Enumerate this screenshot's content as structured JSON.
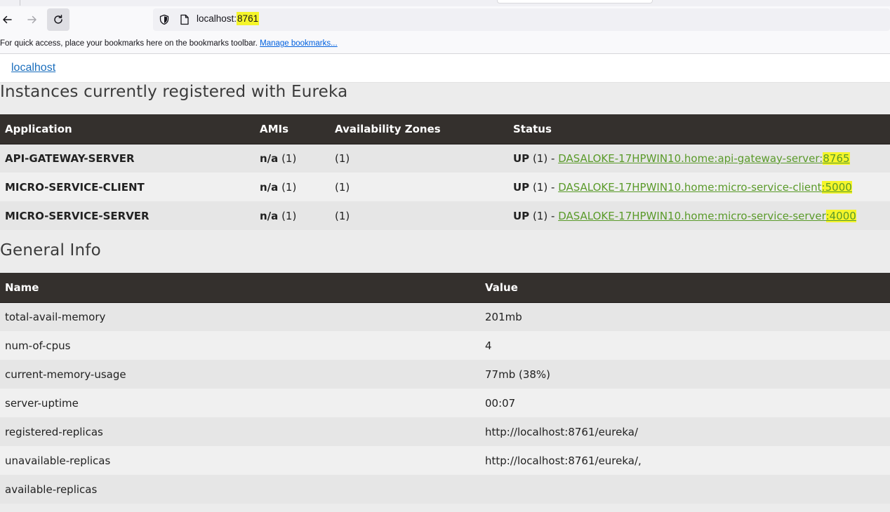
{
  "browser": {
    "url_host": "localhost:",
    "url_port": "8761",
    "bookmarks_message": "For quick access, place your bookmarks here on the bookmarks toolbar.",
    "manage_bookmarks": "Manage bookmarks..."
  },
  "header": {
    "brand": "localhost"
  },
  "instances": {
    "title": "Instances currently registered with Eureka",
    "columns": [
      "Application",
      "AMIs",
      "Availability Zones",
      "Status"
    ],
    "rows": [
      {
        "application": "API-GATEWAY-SERVER",
        "ami_label": "n/a",
        "ami_count": "(1)",
        "zones": "(1)",
        "status": "UP",
        "status_count": "(1) -",
        "link_main": "DASALOKE-17HPWIN10.home:api-gateway-server:",
        "link_port": "8765"
      },
      {
        "application": "MICRO-SERVICE-CLIENT",
        "ami_label": "n/a",
        "ami_count": "(1)",
        "zones": "(1)",
        "status": "UP",
        "status_count": "(1) -",
        "link_main": "DASALOKE-17HPWIN10.home:micro-service-client",
        "link_port": ":5000"
      },
      {
        "application": "MICRO-SERVICE-SERVER",
        "ami_label": "n/a",
        "ami_count": "(1)",
        "zones": "(1)",
        "status": "UP",
        "status_count": "(1) -",
        "link_main": "DASALOKE-17HPWIN10.home:micro-service-server",
        "link_port": ":4000"
      }
    ]
  },
  "general_info": {
    "title": "General Info",
    "columns": [
      "Name",
      "Value"
    ],
    "rows": [
      {
        "name": "total-avail-memory",
        "value": "201mb"
      },
      {
        "name": "num-of-cpus",
        "value": "4"
      },
      {
        "name": "current-memory-usage",
        "value": "77mb (38%)"
      },
      {
        "name": "server-uptime",
        "value": "00:07"
      },
      {
        "name": "registered-replicas",
        "value": "http://localhost:8761/eureka/"
      },
      {
        "name": "unavailable-replicas",
        "value": "http://localhost:8761/eureka/,"
      },
      {
        "name": "available-replicas",
        "value": ""
      }
    ]
  },
  "colors": {
    "header_bg": "#34302d",
    "link_green": "#5a9a2a",
    "highlight": "#f5f52a"
  }
}
